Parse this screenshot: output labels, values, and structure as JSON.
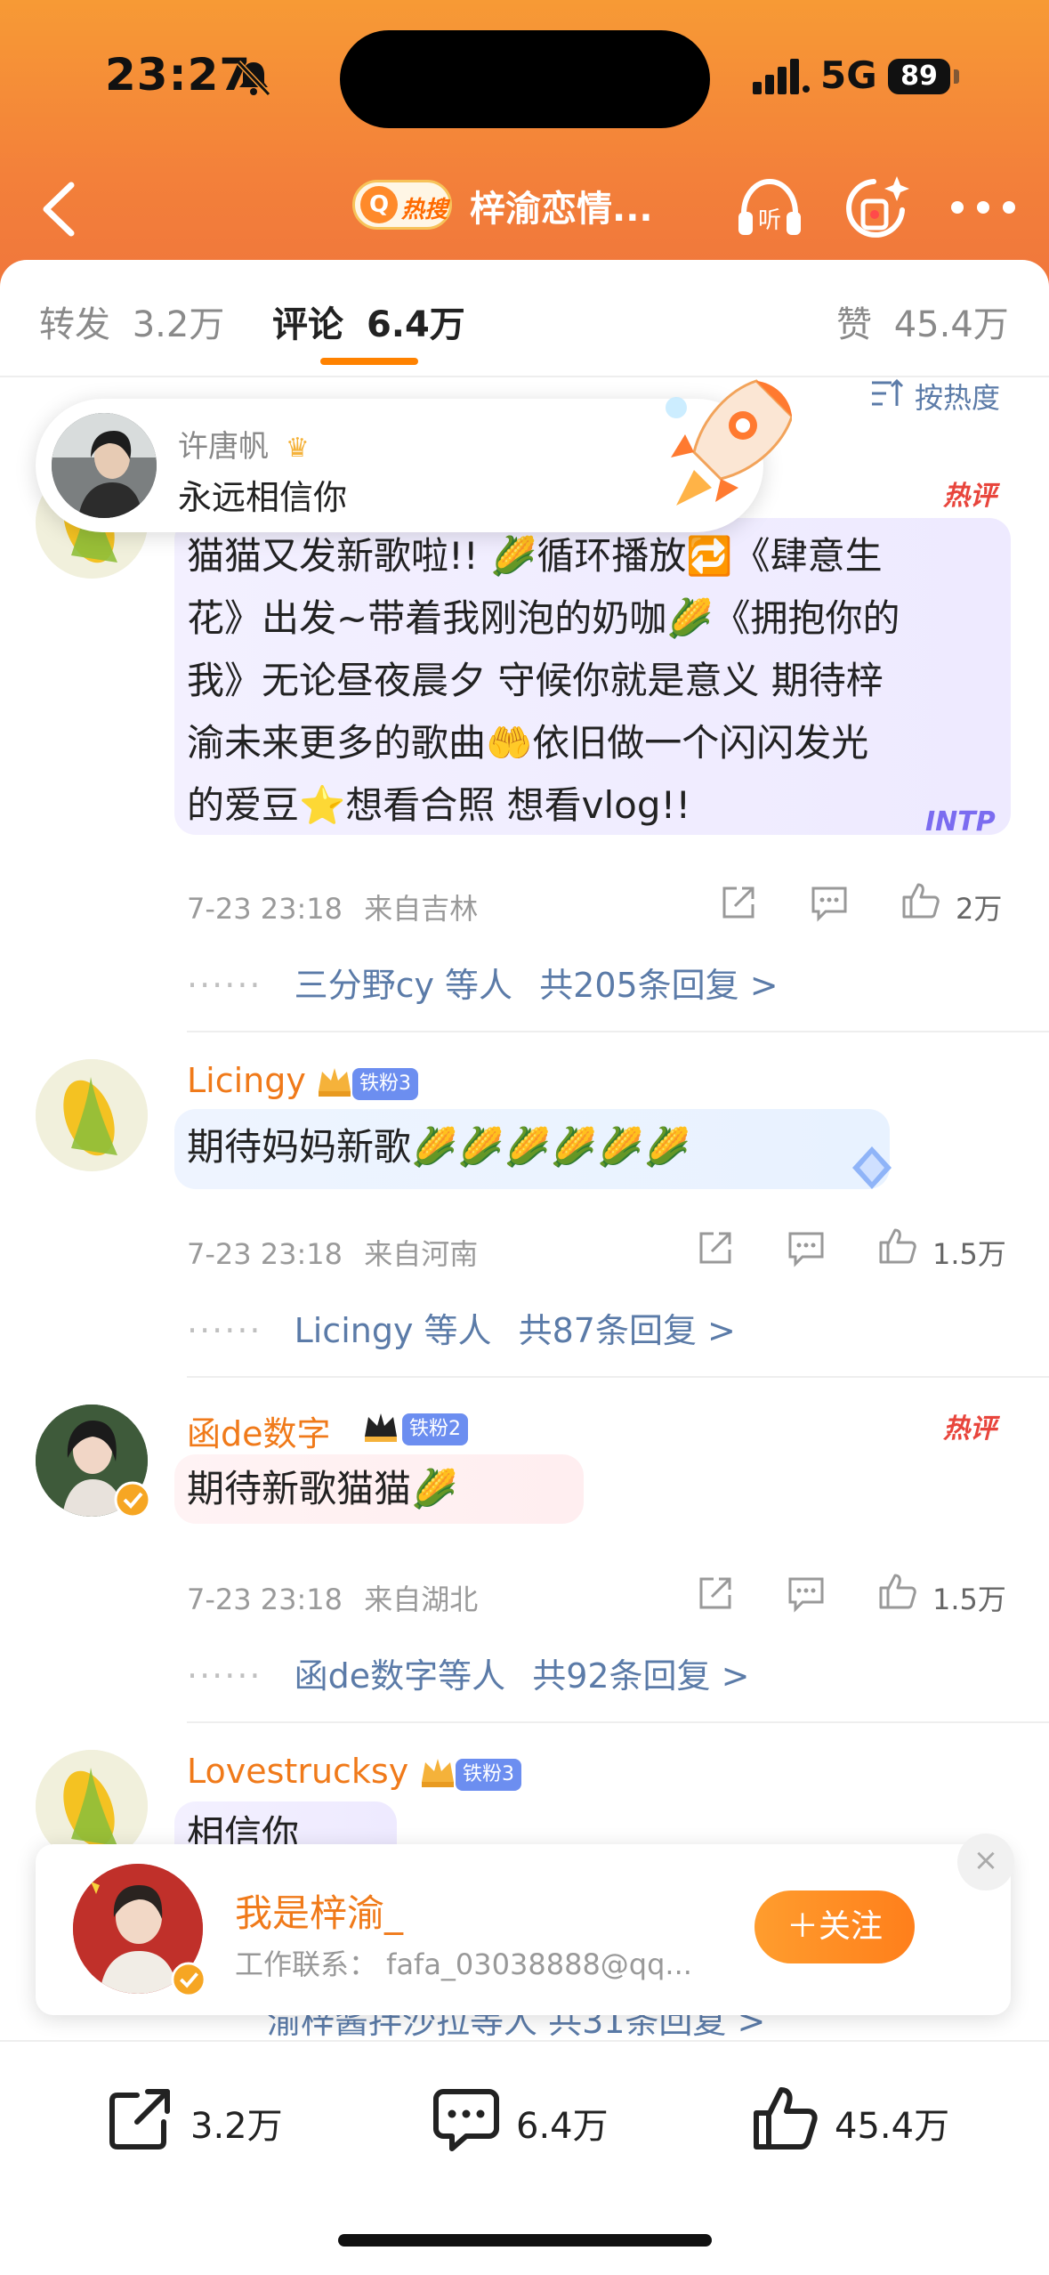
{
  "status_bar": {
    "time": "23:27",
    "network": "5G",
    "battery": "89"
  },
  "nav": {
    "hot_badge": "热搜",
    "title": "梓渝恋情..."
  },
  "tabs": [
    {
      "label": "转发",
      "count": "3.2万"
    },
    {
      "label": "评论",
      "count": "6.4万"
    },
    {
      "label": "赞",
      "count": "45.4万"
    }
  ],
  "sort_label": "按热度",
  "popup": {
    "name": "许唐帆",
    "message": "永远相信你"
  },
  "comments": [
    {
      "username": "",
      "hot": "热评",
      "text_lines": [
        "猫猫又发新歌啦!!  🌽循环播放🔁《肆意生",
        "花》出发~带着我刚泡的奶咖🌽《拥抱你的",
        "我》无论昼夜晨夕 守候你就是意义 期待梓",
        "渝未来更多的歌曲🤲依旧做一个闪闪发光",
        "的爱豆⭐想看合照 想看vlog!!"
      ],
      "time": "7-23 23:18",
      "location": "来自吉林",
      "likes": "2万",
      "reply_names": "三分野cy 等人",
      "reply_count": "共205条回复 >",
      "bubble_tag": "INTP"
    },
    {
      "username": "Licingy",
      "fan_badge": "铁粉3",
      "text": "期待妈妈新歌🌽🌽🌽🌽🌽🌽",
      "time": "7-23 23:18",
      "location": "来自河南",
      "likes": "1.5万",
      "reply_names": "Licingy 等人",
      "reply_count": "共87条回复 >"
    },
    {
      "username": "函de数字",
      "fan_badge": "铁粉2",
      "hot": "热评",
      "text": "期待新歌猫猫🌽",
      "time": "7-23 23:18",
      "location": "来自湖北",
      "likes": "1.5万",
      "reply_names": "函de数字等人",
      "reply_count": "共92条回复 >"
    },
    {
      "username": "Lovestrucksy",
      "fan_badge": "铁粉3",
      "text": "相信你",
      "reply_partial": "渝梓酱拌沙拉等人  共31条回复 >"
    }
  ],
  "follow_card": {
    "name": "我是梓渝_",
    "subtitle": "工作联系：  fafa_03038888@qq...",
    "button": "＋关注",
    "close": "×"
  },
  "bottom_bar": {
    "reposts": "3.2万",
    "comments": "6.4万",
    "likes": "45.4万"
  },
  "colors": {
    "accent": "#ff8200",
    "username": "#f07a1a",
    "link": "#5b7ba8",
    "hot": "#e8453c"
  }
}
